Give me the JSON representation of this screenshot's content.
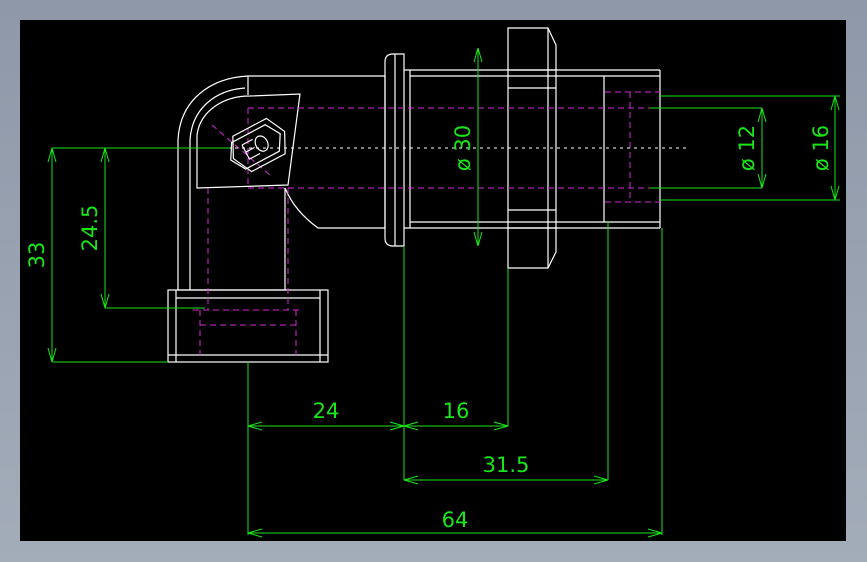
{
  "drawing": {
    "dimensions": {
      "d33": "33",
      "d24_5": "24.5",
      "d30": "ø 30",
      "d12": "ø 12",
      "d16": "ø 16",
      "d24": "24",
      "d16_h": "16",
      "d31_5": "31.5",
      "d64": "64"
    },
    "colors": {
      "background": "#000000",
      "outline": "#ffffff",
      "hidden_lines": "#d22ad2",
      "dimensions": "#19e619"
    },
    "logo_icon": "manufacturer-logo-icon"
  }
}
